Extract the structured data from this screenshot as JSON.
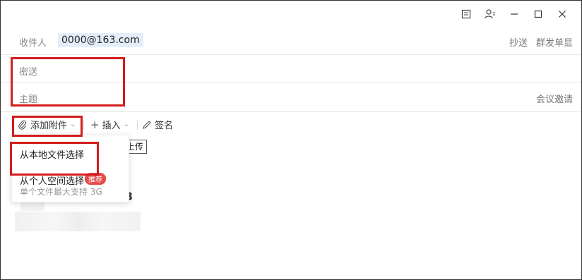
{
  "recipient": {
    "label": "收件人",
    "value": "0000@163.com"
  },
  "header_links": {
    "cc": "抄送",
    "bulk_send": "群发单显"
  },
  "bcc": {
    "label": "密送"
  },
  "subject": {
    "label": "主题",
    "meeting": "会议邀请"
  },
  "toolbar": {
    "attach": "添加附件",
    "insert": "插入",
    "sign": "签名"
  },
  "dropdown": {
    "local_file": "从本地文件选择",
    "cloud_space": "从个人空间选择",
    "cloud_badge": "推荐",
    "cloud_note": "单个文件最大支持 3G"
  },
  "upload_button": "上传",
  "obscured_digit": "3",
  "highlight_color": "#d41c1c"
}
